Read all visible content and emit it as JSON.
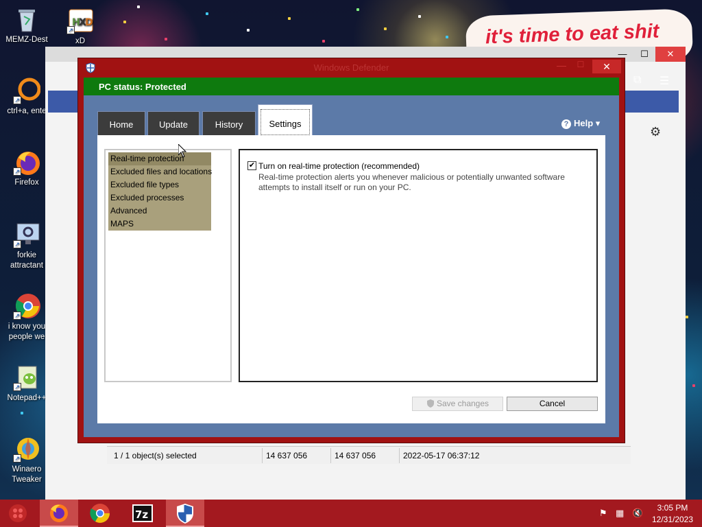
{
  "desktop": {
    "bubble_text": "it's time to eat shit",
    "icons": [
      {
        "label": "MEMZ-Dest",
        "icon": "recycle-bin-icon"
      },
      {
        "label": "xD",
        "icon": "hxd-icon"
      },
      {
        "label": "ctrl+a, ente",
        "icon": "orange-ring-icon"
      },
      {
        "label": "Firefox",
        "icon": "firefox-icon"
      },
      {
        "label": "forkie attractant",
        "icon": "settings-screen-icon"
      },
      {
        "label": "i know you people we",
        "icon": "chrome-icon"
      },
      {
        "label": "Notepad++",
        "icon": "notepadpp-icon"
      },
      {
        "label": "Winaero Tweaker",
        "icon": "winaero-icon"
      }
    ]
  },
  "background_window": {
    "close_glyph": "✕",
    "max_glyph": "☐",
    "min_glyph": "—",
    "status": {
      "selection": "1 / 1 object(s) selected",
      "size1": "14 637 056",
      "size2": "14 637 056",
      "modified": "2022-05-17 06:37:12"
    }
  },
  "defender": {
    "title": "Windows Defender",
    "status": "PC status: Protected",
    "tabs": [
      {
        "label": "Home",
        "active": false
      },
      {
        "label": "Update",
        "active": false
      },
      {
        "label": "History",
        "active": false
      },
      {
        "label": "Settings",
        "active": true
      }
    ],
    "help_label": "Help ▾",
    "settings_list": [
      {
        "label": "Real-time protection",
        "selected": true
      },
      {
        "label": "Excluded files and locations",
        "selected": false
      },
      {
        "label": "Excluded file types",
        "selected": false
      },
      {
        "label": "Excluded processes",
        "selected": false
      },
      {
        "label": "Advanced",
        "selected": false
      },
      {
        "label": "MAPS",
        "selected": false
      }
    ],
    "realtime": {
      "checked": true,
      "label": "Turn on real-time protection (recommended)",
      "description": "Real-time protection alerts you whenever malicious or potentially unwanted software attempts to install itself or run on your PC."
    },
    "save_label": "Save changes",
    "cancel_label": "Cancel",
    "colors": {
      "frame": "#a11212",
      "status_green": "#0e7a0e",
      "body_blue": "#5c7aa8",
      "list_selected": "#928964"
    }
  },
  "taskbar": {
    "start_icon": "start-orb-icon",
    "apps": [
      "firefox-icon",
      "chrome-icon",
      "7zip-icon",
      "defender-icon"
    ],
    "time": "3:05 PM",
    "date": "12/31/2023",
    "tray": [
      "flag-icon",
      "network-icon",
      "volume-muted-icon"
    ]
  }
}
